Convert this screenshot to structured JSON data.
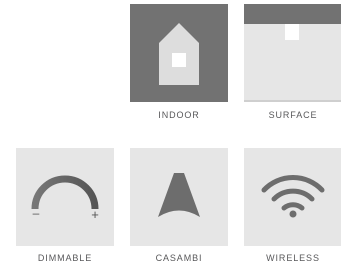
{
  "colors": {
    "tile_dark": "#727272",
    "tile_light": "#e6e6e6",
    "glyph_light": "#dddddd",
    "glyph_dark": "#6d6d6d",
    "label_text": "#58585a"
  },
  "features": [
    {
      "label": "INDOOR",
      "icon": "house-icon",
      "style": "dark"
    },
    {
      "label": "SURFACE",
      "icon": "surface-mount-icon",
      "style": "light"
    },
    {
      "label": "DIMMABLE",
      "icon": "dimmer-dial-icon",
      "style": "light",
      "minus": "–",
      "plus": "+"
    },
    {
      "label": "CASAMBI",
      "icon": "casambi-icon",
      "style": "light"
    },
    {
      "label": "WIRELESS",
      "icon": "wifi-icon",
      "style": "light"
    }
  ]
}
